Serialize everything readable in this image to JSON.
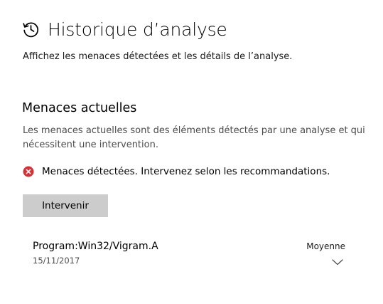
{
  "header": {
    "icon": "history-icon",
    "title": "Historique d’analyse"
  },
  "subtitle": "Affichez les menaces détectées et les détails de l’analyse.",
  "current_threats": {
    "title": "Menaces actuelles",
    "description": "Les menaces actuelles sont des éléments détectés par une analyse et qui nécessitent une intervention.",
    "status": {
      "icon": "error-icon",
      "color": "#d13438",
      "text": "Menaces détectées. Intervenez selon les recommandations."
    },
    "action_button_label": "Intervenir",
    "threats": [
      {
        "name": "Program:Win32/Vigram.A",
        "date": "15/11/2017",
        "severity": "Moyenne",
        "expand_icon": "chevron-down-icon"
      }
    ]
  }
}
